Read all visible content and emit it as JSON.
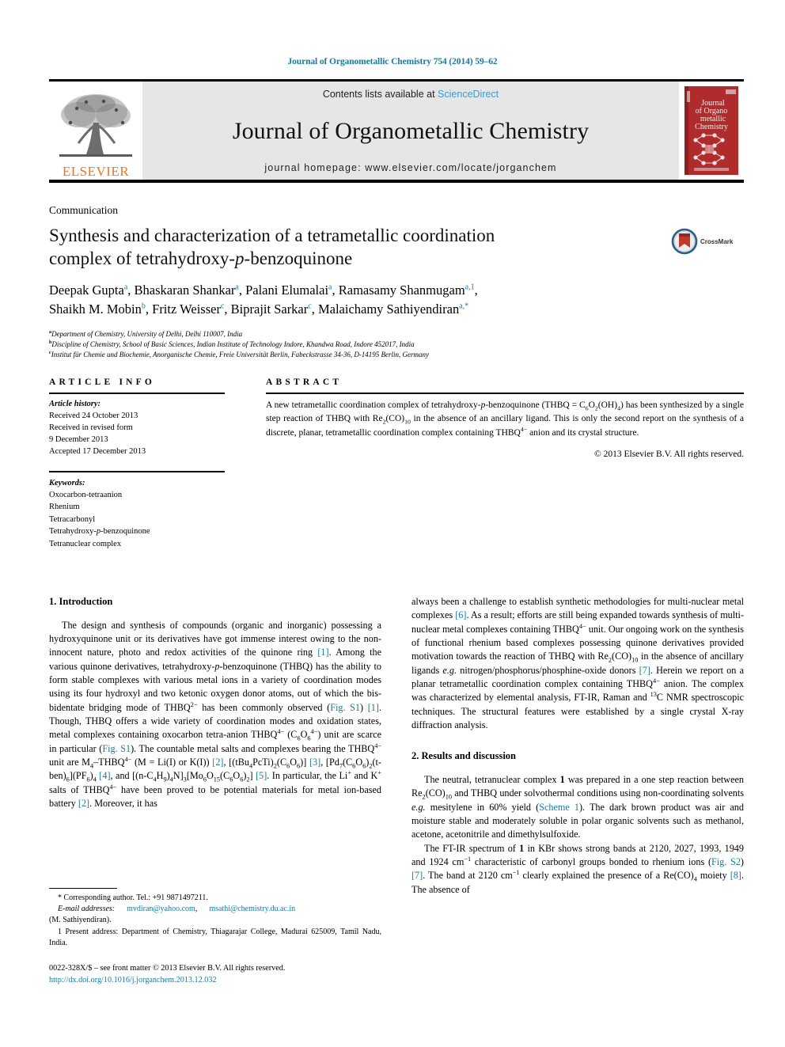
{
  "running_head": "Journal of Organometallic Chemistry 754 (2014) 59–62",
  "masthead": {
    "contents_prefix": "Contents lists available at",
    "sciencedirect": "ScienceDirect",
    "journal_title": "Journal of Organometallic Chemistry",
    "homepage": "journal homepage: www.elsevier.com/locate/jorganchem",
    "publisher_wordmark": "ELSEVIER",
    "cover_title_lines": [
      "Journal",
      "of Organo",
      "metallic",
      "Chemistry"
    ]
  },
  "article": {
    "kicker": "Communication",
    "title_line1": "Synthesis and characterization of a tetrametallic coordination",
    "title_line2_pre": "complex of tetrahydroxy-",
    "title_line2_ital": "p",
    "title_line2_post": "-benzoquinone",
    "crossmark_label": "CrossMark",
    "authors": [
      {
        "name": "Deepak Gupta",
        "marks": "a",
        "sep": ", "
      },
      {
        "name": "Bhaskaran Shankar",
        "marks": "a",
        "sep": ", "
      },
      {
        "name": "Palani Elumalai",
        "marks": "a",
        "sep": ", "
      },
      {
        "name": "Ramasamy Shanmugam",
        "marks": "a,1",
        "sep": ", "
      },
      {
        "name": "Shaikh M. Mobin",
        "marks": "b",
        "sep": ", "
      },
      {
        "name": "Fritz Weisser",
        "marks": "c",
        "sep": ", "
      },
      {
        "name": "Biprajit Sarkar",
        "marks": "c",
        "sep": ", "
      },
      {
        "name": "Malaichamy Sathiyendiran",
        "marks": "a,*",
        "sep": ""
      }
    ],
    "affiliations": [
      {
        "mark": "a",
        "text": "Department of Chemistry, University of Delhi, Delhi 110007, India"
      },
      {
        "mark": "b",
        "text": "Discipline of Chemistry, School of Basic Sciences, Indian Institute of Technology Indore, Khandwa Road, Indore 452017, India"
      },
      {
        "mark": "c",
        "text": "Institut für Chemie und Biochemie, Anorganische Chemie, Freie Universität Berlin, Fabeckstrasse 34-36, D-14195 Berlin, Germany"
      }
    ]
  },
  "info": {
    "heading": "ARTICLE INFO",
    "history_label": "Article history:",
    "history": [
      "Received 24 October 2013",
      "Received in revised form",
      "9 December 2013",
      "Accepted 17 December 2013"
    ],
    "keywords_label": "Keywords:",
    "keywords_plain": [
      "Oxocarbon-tetraanion",
      "Rhenium",
      "Tetracarbonyl",
      "Tetranuclear complex"
    ],
    "keyword_thbq_pre": "Tetrahydroxy-",
    "keyword_thbq_ital": "p",
    "keyword_thbq_post": "-benzoquinone"
  },
  "abstract": {
    "heading": "ABSTRACT",
    "copyright": "© 2013 Elsevier B.V. All rights reserved."
  },
  "sections": {
    "intro_heading": "1. Introduction",
    "results_heading": "2. Results and discussion"
  },
  "footnotes": {
    "corresponding": "* Corresponding author. Tel.: +91 9871497211.",
    "email_label": "E-mail addresses:",
    "email1": "mvdiran@yahoo.com",
    "email2": "msathi@chemistry.du.ac.in",
    "email_owner": "(M. Sathiyendiran).",
    "present_address": "1 Present address: Department of Chemistry, Thiagarajar College, Madurai 625009, Tamil Nadu, India."
  },
  "colophon": {
    "line1": "0022-328X/$ – see front matter © 2013 Elsevier B.V. All rights reserved.",
    "doi": "http://dx.doi.org/10.1016/j.jorganchem.2013.12.032"
  }
}
